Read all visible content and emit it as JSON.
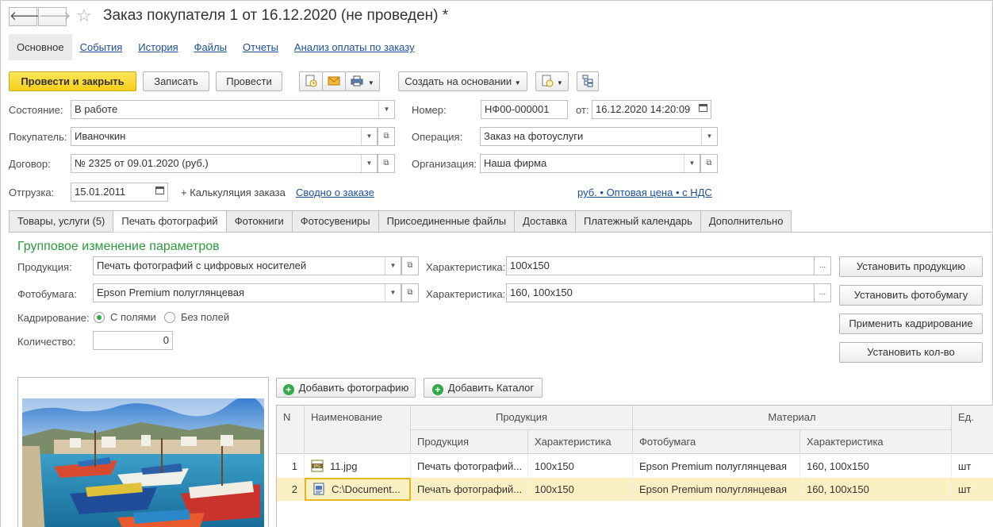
{
  "window": {
    "title": "Заказ покупателя 1 от 16.12.2020 (не проведен) *",
    "back_glyph": "🡐",
    "forward_glyph": "🡒",
    "star_glyph": "☆"
  },
  "nav_tabs": [
    {
      "label": "Основное",
      "active": true
    },
    {
      "label": "События"
    },
    {
      "label": "История"
    },
    {
      "label": "Файлы"
    },
    {
      "label": "Отчеты"
    },
    {
      "label": "Анализ оплаты по заказу"
    }
  ],
  "toolbar": {
    "post_close": "Провести и закрыть",
    "save": "Записать",
    "post": "Провести",
    "create_based": "Создать на основании"
  },
  "header": {
    "state": {
      "label": "Состояние:",
      "value": "В работе"
    },
    "number": {
      "label": "Номер:",
      "value": "НФ00-000001"
    },
    "date": {
      "label": "от:",
      "value": "16.12.2020 14:20:09"
    },
    "buyer": {
      "label": "Покупатель:",
      "value": "Иваночкин"
    },
    "operation": {
      "label": "Операция:",
      "value": "Заказ на фотоуслуги"
    },
    "contract": {
      "label": "Договор:",
      "value": "№ 2325 от 09.01.2020 (руб.)"
    },
    "organization": {
      "label": "Организация:",
      "value": "Наша фирма"
    },
    "shipment": {
      "label": "Отгрузка:",
      "value": "15.01.2011"
    },
    "calc_link": "+ Калькуляция заказа",
    "summary_link": "Сводно о заказе",
    "price_link": "руб. • Оптовая цена • с НДС"
  },
  "doc_tabs": [
    {
      "label": "Товары, услуги (5)"
    },
    {
      "label": "Печать фотографий",
      "active": true
    },
    {
      "label": "Фотокниги"
    },
    {
      "label": "Фотосувениры"
    },
    {
      "label": "Присоединенные файлы"
    },
    {
      "label": "Доставка"
    },
    {
      "label": "Платежный календарь"
    },
    {
      "label": "Дополнительно"
    }
  ],
  "group": {
    "title": "Групповое изменение параметров",
    "product_label": "Продукция:",
    "product_value": "Печать фотографий  с цифровых носителей",
    "char_label": "Характеристика:",
    "product_char_value": "100x150",
    "paper_label": "Фотобумага:",
    "paper_value": "Epson Premium полуглянцевая",
    "paper_char_value": "160, 100x150",
    "crop_label": "Кадрирование:",
    "crop_with_margins": "С полями",
    "crop_no_margins": "Без полей",
    "qty_label": "Количество:",
    "qty_value": "0",
    "btn_set_product": "Установить продукцию",
    "btn_set_paper": "Установить фотобумагу",
    "btn_apply_crop": "Применить кадрирование",
    "btn_set_qty": "Установить кол-во",
    "ellipsis": "..."
  },
  "photos": {
    "add_photo": "Добавить фотографию",
    "add_catalog": "Добавить Каталог"
  },
  "table": {
    "headers": {
      "n": "N",
      "name": "Наименование",
      "product_group": "Продукция",
      "material_group": "Материал",
      "unit": "Ед.",
      "product": "Продукция",
      "product_char": "Характеристика",
      "paper": "Фотобумага",
      "paper_char": "Характеристика"
    },
    "rows": [
      {
        "n": "1",
        "name": "11.jpg",
        "product": "Печать фотографий...",
        "product_char": "100x150",
        "paper": "Epson Premium полуглянцевая",
        "paper_char": "160, 100x150",
        "unit": "шт"
      },
      {
        "n": "2",
        "name": "C:\\Document...",
        "product": "Печать фотографий...",
        "product_char": "100x150",
        "paper": "Epson Premium полуглянцевая",
        "paper_char": "160, 100x150",
        "unit": "шт"
      }
    ]
  },
  "colors": {
    "accent_green": "#2a9a3a",
    "primary_yellow": "#f5cf1a",
    "link_blue": "#1b4f9b",
    "selected_row": "#fbf0c4"
  }
}
